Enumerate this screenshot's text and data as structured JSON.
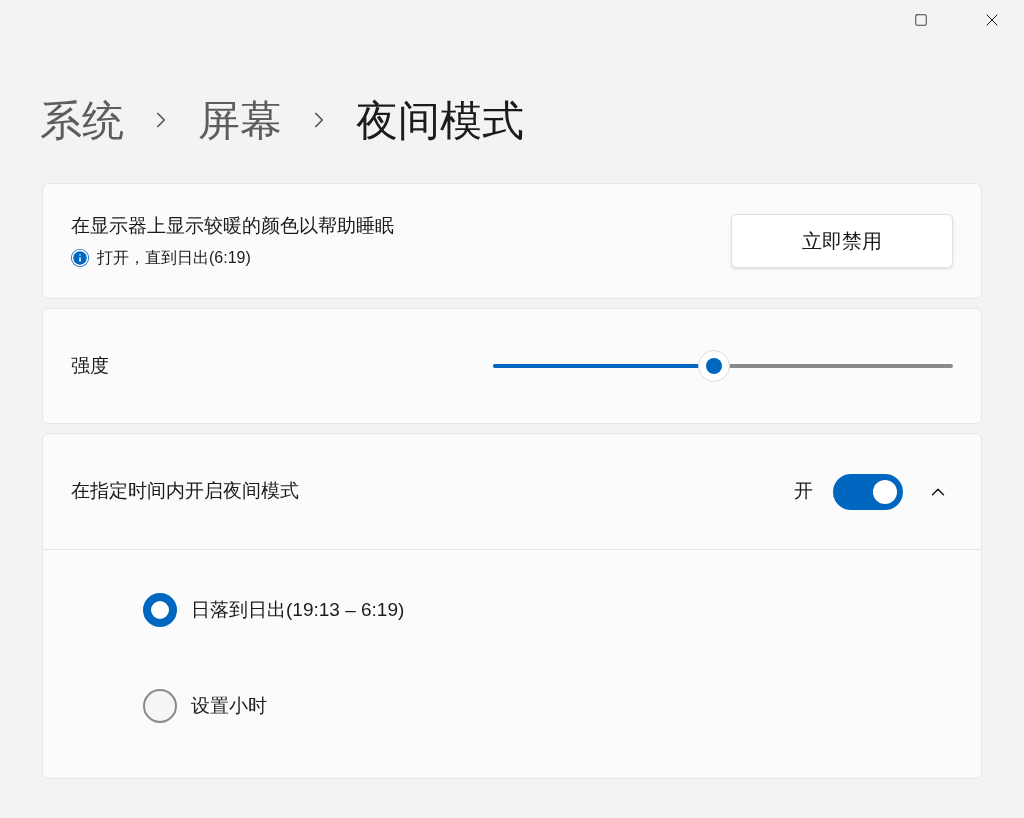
{
  "breadcrumb": [
    {
      "label": "系统",
      "current": false
    },
    {
      "label": "屏幕",
      "current": false
    },
    {
      "label": "夜间模式",
      "current": true
    }
  ],
  "status_card": {
    "title": "在显示器上显示较暖的颜色以帮助睡眠",
    "status": "打开，直到日出(6:19)",
    "button": "立即禁用"
  },
  "strength": {
    "label": "强度",
    "level": 0.48
  },
  "schedule": {
    "label": "在指定时间内开启夜间模式",
    "toggle_label": "开",
    "on": true,
    "expanded": true,
    "options": [
      {
        "label": "日落到日出(19:13 – 6:19)",
        "selected": true
      },
      {
        "label": "设置小时",
        "selected": false
      }
    ]
  }
}
